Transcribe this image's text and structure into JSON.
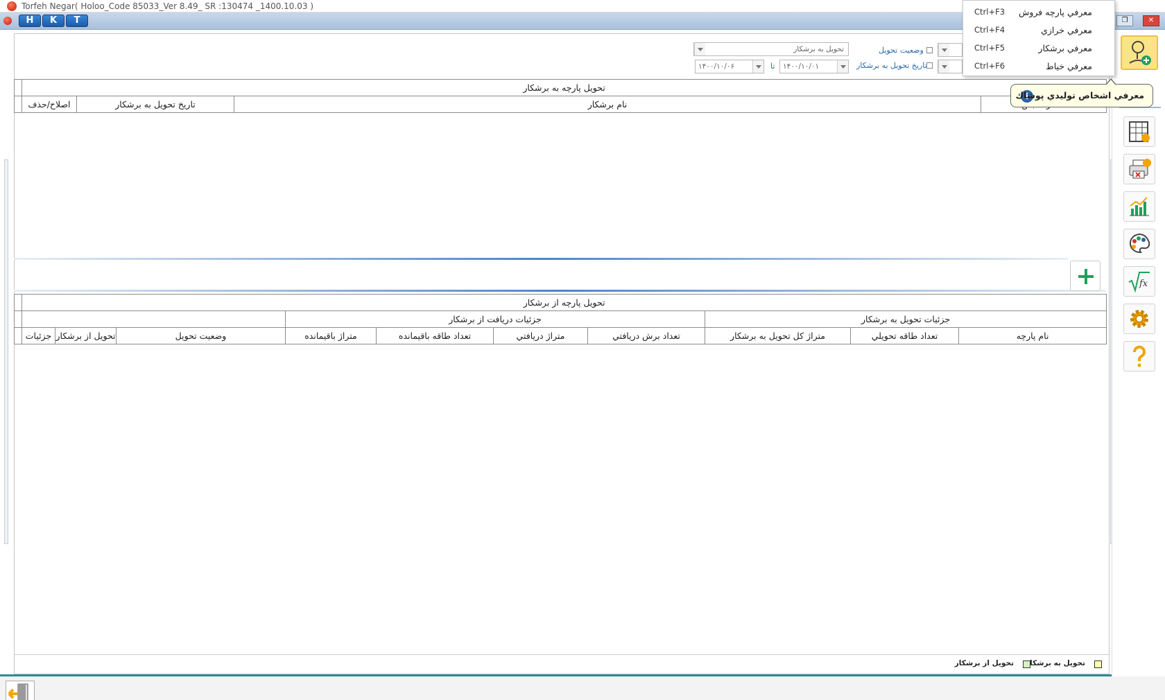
{
  "window": {
    "title": "Torfeh Negar( Holoo_Code  85033_Ver 8.49_ SR :130474 _1400.10.03 )",
    "hkt_buttons": [
      "H",
      "K",
      "T"
    ],
    "restore_glyph": "❐",
    "close_glyph": "✕"
  },
  "filters": {
    "delivery_type_value": "تحويل به برشكار",
    "delivery_status_label": "وضعيت تحويل",
    "delivery_date_label": "تاريخ تحويل به برشكار",
    "date_from": "۱۴۰۰/۱۰/۰۱",
    "to_label": "تا",
    "date_to": "۱۴۰۰/۱۰/۰۶"
  },
  "top_grid": {
    "caption": "تحويل پارچه به برشكار",
    "columns": [
      "شماره قبض",
      "نام برشكار",
      "تاريخ تحويل به برشكار",
      "اصلاح/حذف"
    ]
  },
  "bottom_grid": {
    "caption": "تحويل پارچه از برشكار",
    "group_delivery": "جزئيات تحويل به برشكار",
    "group_receive": "جزئيات دريافت از برشكار",
    "columns": [
      "نام پارچه",
      "تعداد طاقه تحويلي",
      "متراژ كل تحويل به برشكار",
      "تعداد برش دريافتي",
      "متراژ دريافتي",
      "تعداد طاقه باقيمانده",
      "متراژ باقيمانده",
      "وضعيت تحويل",
      "تحويل از برشكار",
      "جزئيات"
    ]
  },
  "legend": {
    "to_cutter": "تحويل به برشكار",
    "from_cutter": "تحويل از برشكار"
  },
  "dropdown_menu": {
    "items": [
      {
        "label": "معرفي پارچه فروش",
        "shortcut": "Ctrl+F3"
      },
      {
        "label": "معرفي خرازي",
        "shortcut": "Ctrl+F4"
      },
      {
        "label": "معرفي برشكار",
        "shortcut": "Ctrl+F5"
      },
      {
        "label": "معرفي خياط",
        "shortcut": "Ctrl+F6"
      }
    ]
  },
  "tooltip": {
    "icon": "i",
    "text": "معرفي اشخاص توليدي پوشاك"
  },
  "right_toolbar": {
    "icons": [
      "person-add-icon",
      "table-edit-icon",
      "printer-cancel-icon",
      "bar-chart-icon",
      "palette-icon",
      "formula-icon",
      "gear-icon",
      "help-icon"
    ]
  },
  "colors": {
    "accent_blue": "#2a6aad",
    "add_green": "#1aa35a",
    "active_tool": "#fbe487",
    "bottom_bar_teal": "#2a8c98"
  }
}
